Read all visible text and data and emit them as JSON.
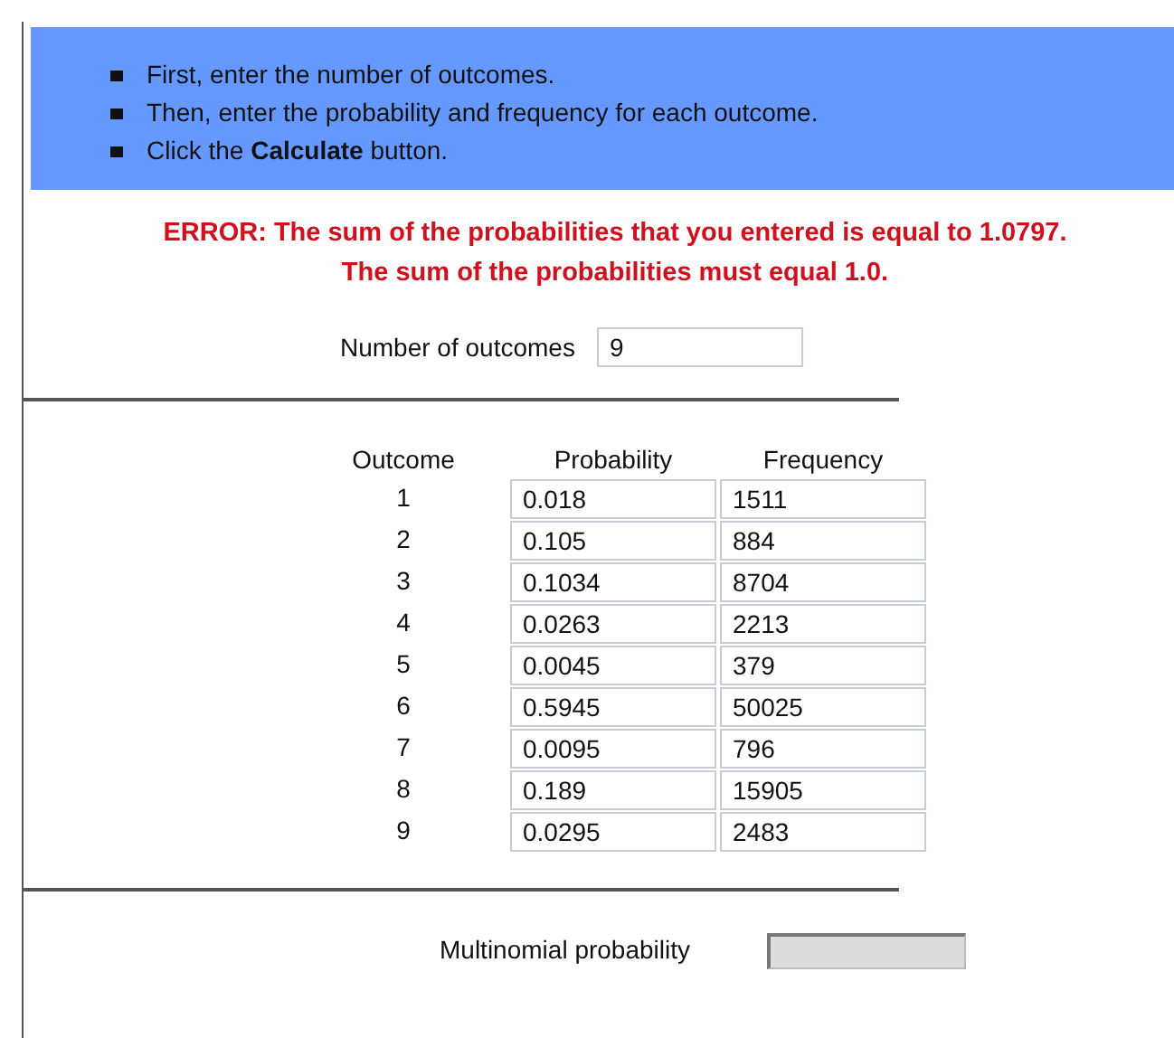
{
  "instructions": [
    "First, enter the number of outcomes.",
    "Then, enter the probability and frequency for each outcome.",
    "Click the **Calculate** button."
  ],
  "error": "ERROR: The sum of the probabilities that you entered is equal to 1.0797. The sum of the probabilities must equal 1.0.",
  "number_of_outcomes": {
    "label": "Number of outcomes",
    "value": "9"
  },
  "table": {
    "columns": [
      "Outcome",
      "Probability",
      "Frequency"
    ],
    "rows": [
      {
        "outcome": "1",
        "probability": "0.018",
        "frequency": "1511"
      },
      {
        "outcome": "2",
        "probability": "0.105",
        "frequency": "884"
      },
      {
        "outcome": "3",
        "probability": "0.1034",
        "frequency": "8704"
      },
      {
        "outcome": "4",
        "probability": "0.0263",
        "frequency": "2213"
      },
      {
        "outcome": "5",
        "probability": "0.0045",
        "frequency": "379"
      },
      {
        "outcome": "6",
        "probability": "0.5945",
        "frequency": "50025"
      },
      {
        "outcome": "7",
        "probability": "0.0095",
        "frequency": "796"
      },
      {
        "outcome": "8",
        "probability": "0.189",
        "frequency": "15905"
      },
      {
        "outcome": "9",
        "probability": "0.0295",
        "frequency": "2483"
      }
    ]
  },
  "result": {
    "label": "Multinomial probability",
    "readonly": true
  }
}
